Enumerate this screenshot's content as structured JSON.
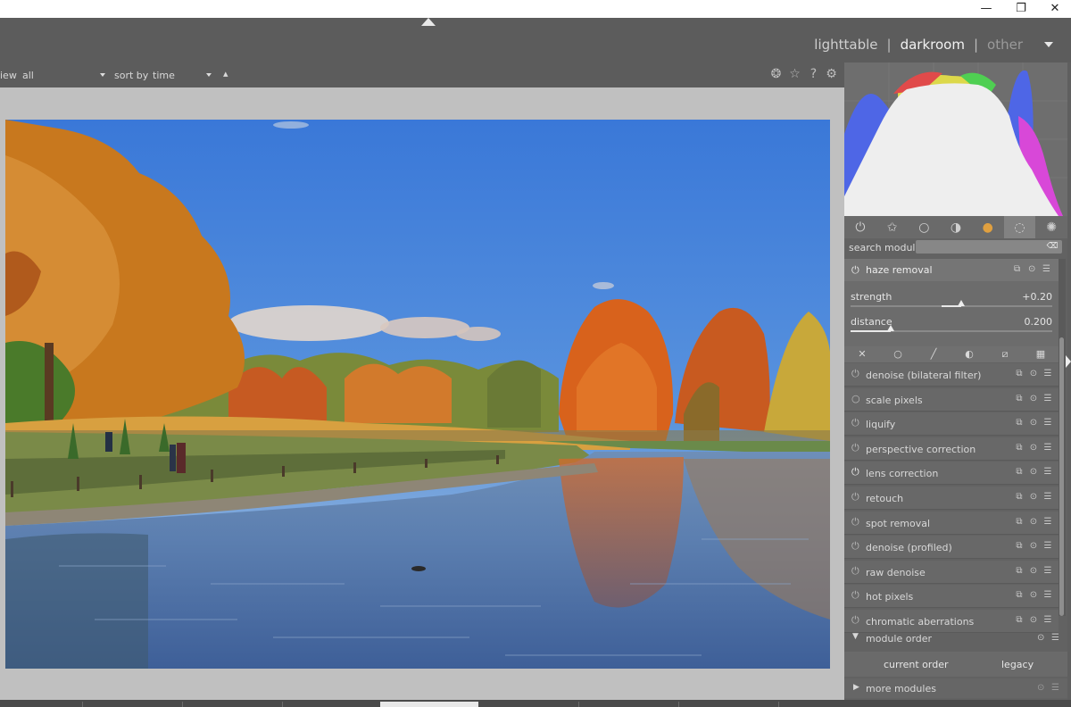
{
  "window": {
    "minimize": "—",
    "restore": "❐",
    "close": "✕"
  },
  "header": {
    "views": [
      "lighttable",
      "darkroom",
      "other"
    ],
    "separator": "|"
  },
  "filterbar": {
    "view_label": "iew",
    "view_value": "all",
    "sort_label": "sort by",
    "sort_value": "time",
    "sort_dir": "▴"
  },
  "histogram": {
    "colors": {
      "red": "#e04a4a",
      "green": "#4fcf52",
      "blue": "#4e66e6",
      "yellow": "#dcd84a",
      "magenta": "#d848d8",
      "white": "#eeeeee"
    }
  },
  "module_groups": [
    "power-icon",
    "star-icon",
    "circle-icon",
    "half-circle-icon",
    "color-ball-icon",
    "correct-icon",
    "effects-icon"
  ],
  "search": {
    "label": "search module",
    "value": ""
  },
  "haze_removal": {
    "name": "haze removal",
    "strength_label": "strength",
    "strength_value": "+0.20",
    "strength_fraction": 0.55,
    "distance_label": "distance",
    "distance_value": "0.200",
    "distance_fraction": 0.2
  },
  "blend_modes": [
    "✕",
    "○",
    "╱",
    "◐",
    "⧄",
    "▦"
  ],
  "modules": [
    {
      "name": "denoise (bilateral filter)",
      "on": false
    },
    {
      "name": "scale pixels",
      "on": false
    },
    {
      "name": "liquify",
      "on": false
    },
    {
      "name": "perspective correction",
      "on": false
    },
    {
      "name": "lens correction",
      "on": true
    },
    {
      "name": "retouch",
      "on": false
    },
    {
      "name": "spot removal",
      "on": false
    },
    {
      "name": "denoise (profiled)",
      "on": false
    },
    {
      "name": "raw denoise",
      "on": false
    },
    {
      "name": "hot pixels",
      "on": false
    },
    {
      "name": "chromatic aberrations",
      "on": false
    }
  ],
  "module_order": {
    "label": "module order",
    "current": "current order",
    "legacy": "legacy"
  },
  "more_modules": {
    "label": "more modules"
  }
}
